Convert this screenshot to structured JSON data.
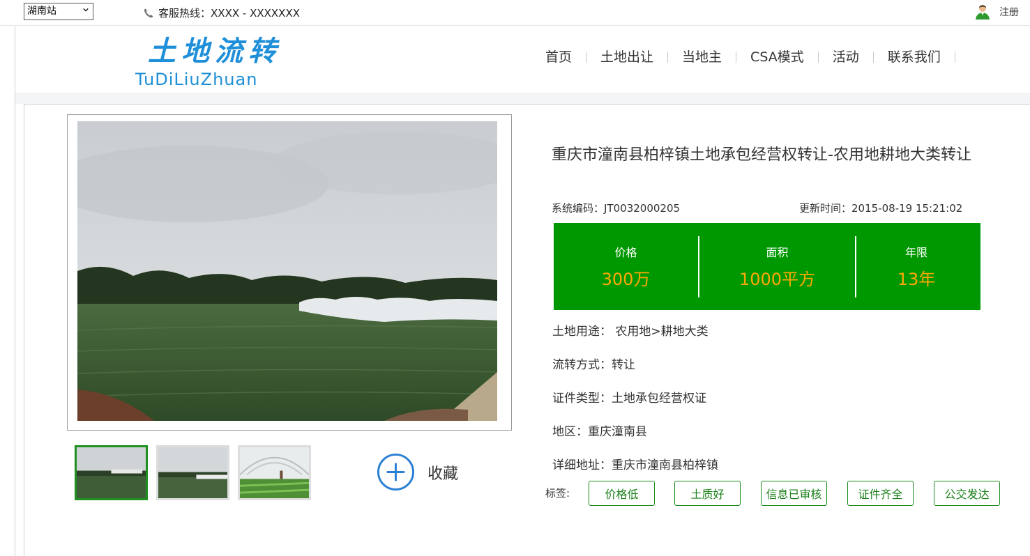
{
  "topbar": {
    "station": "湖南站",
    "hotline_label": "客服热线：",
    "hotline_number": "XXXX - XXXXXXX",
    "register_label": "注册"
  },
  "logo": {
    "cn": "土地流转",
    "en": "TuDiLiuZhuan",
    "color": "#1e8fd8"
  },
  "nav": {
    "items": [
      {
        "label": "首页"
      },
      {
        "label": "土地出让"
      },
      {
        "label": "当地主"
      },
      {
        "label": "CSA模式"
      },
      {
        "label": "活动"
      },
      {
        "label": "联系我们"
      }
    ]
  },
  "gallery": {
    "favorite_label": "收藏"
  },
  "listing": {
    "title": "重庆市潼南县柏梓镇土地承包经营权转让-农用地耕地大类转让",
    "system_code_label": "系统编码：",
    "system_code": "JT0032000205",
    "update_time_label": "更新时间：",
    "update_time": "2015-08-19 15:21:02",
    "stats": {
      "price_label": "价格",
      "price_value": "300万",
      "area_label": "面积",
      "area_value": "1000平方",
      "term_label": "年限",
      "term_value": "13年",
      "background_color": "#009800",
      "value_color": "#ffa800"
    },
    "attributes": {
      "land_use_label": "土地用途：",
      "land_use": "农用地>耕地大类",
      "transfer_method_label": "流转方式：",
      "transfer_method": "转让",
      "certificate_type_label": "证件类型：",
      "certificate_type": "土地承包经营权证",
      "region_label": "地区：",
      "region": "重庆潼南县",
      "address_label": "详细地址：",
      "address": "重庆市潼南县柏梓镇"
    },
    "tags_label": "标签:",
    "tags": [
      "价格低",
      "土质好",
      "信息已审核",
      "证件齐全",
      "公交发达"
    ],
    "tag_color": "#1a8a1a"
  }
}
